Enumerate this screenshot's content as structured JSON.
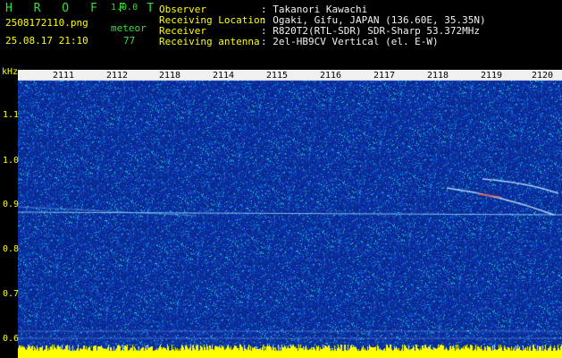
{
  "header": {
    "brand": "H R O F F T",
    "version": "1.0.0",
    "filename": "2508172110.png",
    "datetime": "25.08.17 21:10",
    "meteor_label": "meteor",
    "meteor_count": "77"
  },
  "info": [
    {
      "key": "Observer",
      "value": ": Takanori Kawachi"
    },
    {
      "key": "Receiving Location",
      "value": ": Ogaki, Gifu, JAPAN (136.60E, 35.35N)"
    },
    {
      "key": "Receiver",
      "value": ": R820T2(RTL-SDR) SDR-Sharp 53.372MHz"
    },
    {
      "key": "Receiving antenna",
      "value": ": 2el-HB9CV Vertical (el. E-W)"
    }
  ],
  "axis": {
    "unit": "kHz",
    "y_ticks": [
      "1.1",
      "1.0",
      "0.9",
      "0.8",
      "0.7",
      "0.6"
    ],
    "x_ticks": [
      "2111",
      "2112",
      "2118",
      "2114",
      "2115",
      "2116",
      "2117",
      "2118",
      "2119",
      "2120"
    ]
  },
  "colors": {
    "background": "#000000",
    "label_green": "#2ee32e",
    "label_yellow": "#ffff00",
    "spectro_base": "#0a1f8c",
    "signal_line": "#9fe0ff"
  }
}
